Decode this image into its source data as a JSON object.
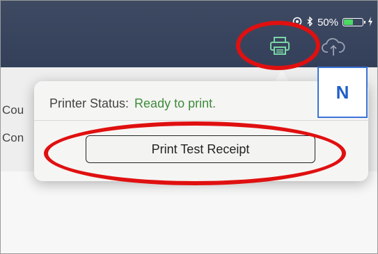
{
  "status_bar": {
    "battery_percent": "50%",
    "battery_level": 0.5,
    "icons": [
      "location-icon",
      "bluetooth-icon",
      "battery-icon",
      "charging-icon"
    ]
  },
  "toolbar": {
    "printer_icon": "printer-icon",
    "cloud_icon": "cloud-upload-icon"
  },
  "background_rows": [
    "Cou",
    "Con"
  ],
  "popover": {
    "status_label": "Printer Status:",
    "status_value": "Ready to print.",
    "test_button_label": "Print Test Receipt"
  },
  "annotation": {
    "label": "N",
    "circle_color": "#e01010",
    "label_color": "#1f5fc9"
  },
  "colors": {
    "navbar": "#3b4760",
    "status_ready": "#3d8b3a",
    "battery_fill": "#4cd964"
  }
}
